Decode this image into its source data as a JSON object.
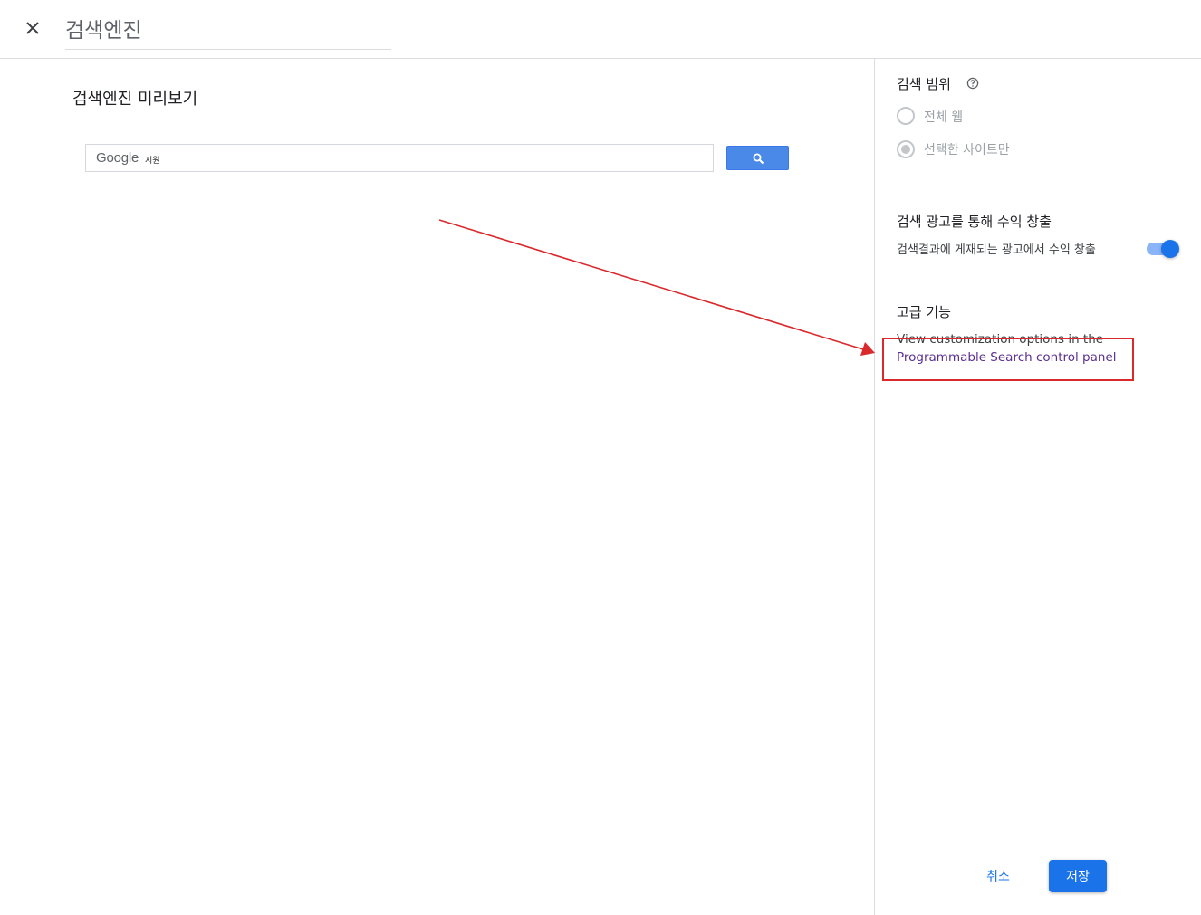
{
  "header": {
    "title": "검색엔진",
    "close_icon": "close-icon"
  },
  "preview": {
    "heading": "검색엔진 미리보기",
    "logo_text": "Google",
    "logo_sub": "지원",
    "search_icon": "search-icon"
  },
  "scope": {
    "label": "검색 범위",
    "help_icon": "help-circle-icon",
    "options": [
      {
        "label": "전체 웹",
        "selected": false
      },
      {
        "label": "선택한 사이트만",
        "selected": true
      }
    ]
  },
  "ads": {
    "label": "검색 광고를 통해 수익 창출",
    "description": "검색결과에 게재되는 광고에서 수익 창출",
    "toggle_on": true
  },
  "advanced": {
    "label": "고급 기능",
    "text": "View customization options in the",
    "link": "Programmable Search control panel"
  },
  "footer": {
    "cancel": "취소",
    "save": "저장"
  },
  "colors": {
    "accent": "#1a73e8",
    "annotation": "#d9292c",
    "link": "#5b2f91"
  }
}
